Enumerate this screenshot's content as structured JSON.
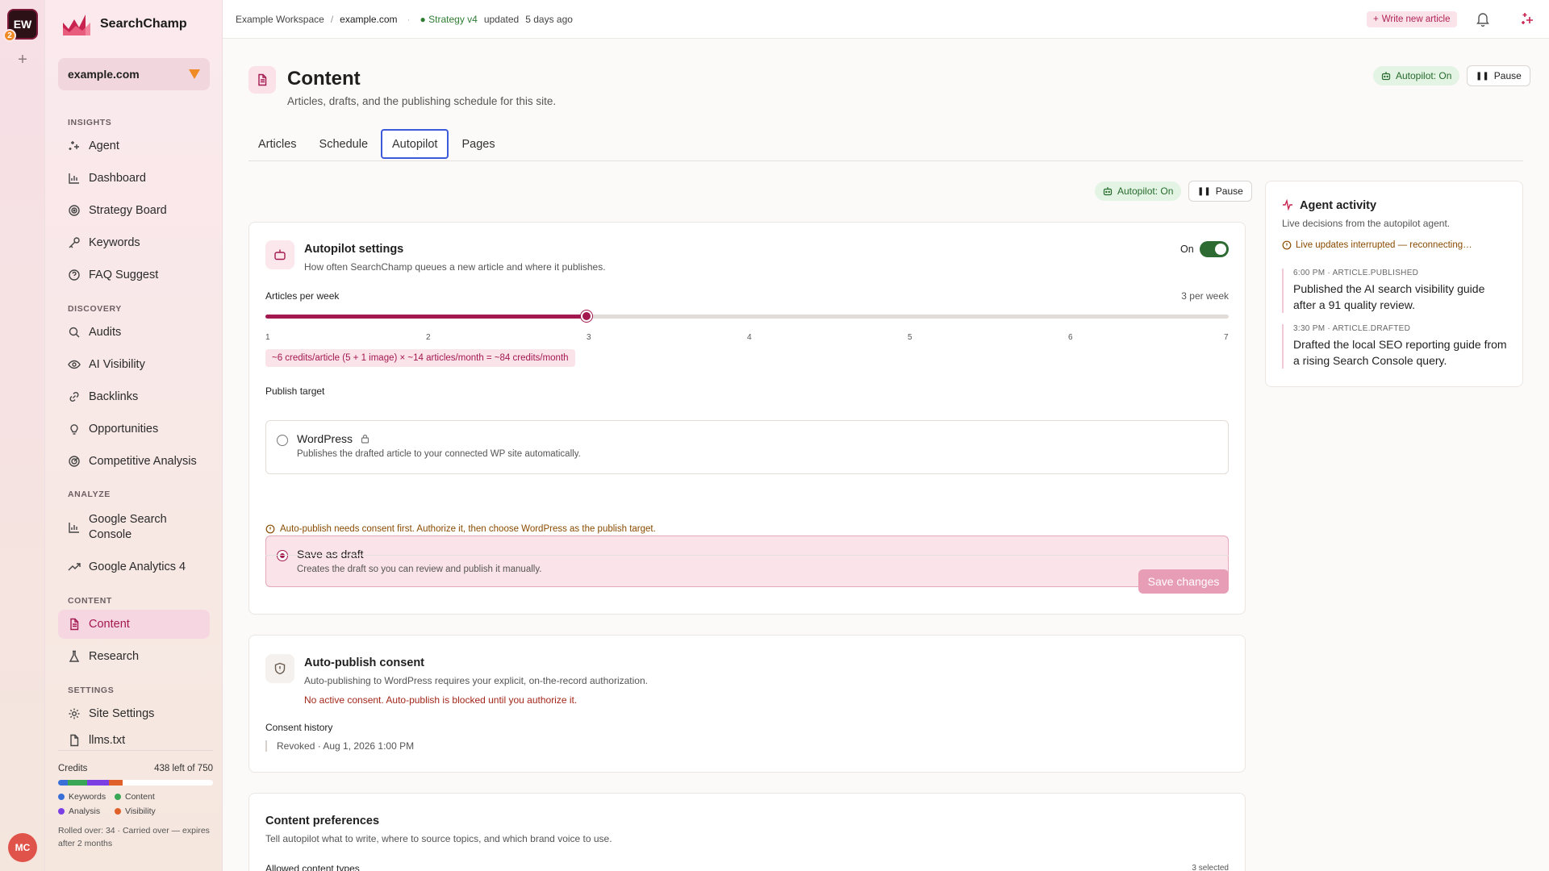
{
  "workspace": {
    "initials": "EW",
    "badge": "2",
    "add_label": "+"
  },
  "user": {
    "initials": "MC"
  },
  "brand": {
    "name": "SearchChamp"
  },
  "site_selector": {
    "value": "example.com"
  },
  "sidebar": {
    "insights_label": "INSIGHTS",
    "insights": [
      "Agent",
      "Dashboard",
      "Strategy Board",
      "Keywords",
      "FAQ Suggest"
    ],
    "discovery_label": "DISCOVERY",
    "discovery": [
      "Audits",
      "AI Visibility",
      "Backlinks",
      "Opportunities",
      "Competitive Analysis"
    ],
    "analyze_label": "ANALYZE",
    "analyze": [
      "Google Search Console",
      "Google Analytics 4"
    ],
    "content_label": "CONTENT",
    "content": [
      "Content",
      "Research"
    ],
    "settings_label": "SETTINGS",
    "settings": [
      "Site Settings",
      "llms.txt"
    ]
  },
  "credits": {
    "label": "Credits",
    "remaining": "438 left of 750",
    "segments": [
      {
        "name": "Keywords",
        "fraction": 0.06,
        "color": "#3b6fd8"
      },
      {
        "name": "Content",
        "fraction": 0.125,
        "color": "#3aa757"
      },
      {
        "name": "Analysis",
        "fraction": 0.145,
        "color": "#7b3fe4"
      },
      {
        "name": "Visibility",
        "fraction": 0.085,
        "color": "#e0602a"
      }
    ],
    "legend": [
      "Keywords",
      "Content",
      "Analysis",
      "Visibility"
    ],
    "rolled": "Rolled over: 34 · Carried over — expires after 2 months"
  },
  "topbar": {
    "workspace": "Example Workspace",
    "separator": "/",
    "site": "example.com",
    "strategy": "● Strategy v4",
    "updated": "updated",
    "updated_ago": "5 days ago",
    "write_button": "Write new article"
  },
  "header": {
    "title": "Content",
    "subtitle": "Articles, drafts, and the publishing schedule for this site.",
    "autopilot_status": "Autopilot: On",
    "pause_label": "Pause"
  },
  "tabs": [
    "Articles",
    "Schedule",
    "Autopilot",
    "Pages"
  ],
  "active_tab": "Autopilot",
  "autopilot_settings": {
    "title": "Autopilot settings",
    "description": "How often SearchChamp queues a new article and where it publishes.",
    "toggle_label": "On",
    "toggle_on": true,
    "slider_label": "Articles per week",
    "slider_value_text": "3 per week",
    "slider_value": 3,
    "slider_min": 1,
    "slider_max": 7,
    "ticks": [
      "1",
      "2",
      "3",
      "4",
      "5",
      "6",
      "7"
    ],
    "calc": "~6 credits/article (5 + 1 image) × ~14 articles/month = ~84 credits/month",
    "publish_target_label": "Publish target",
    "options": [
      {
        "title": "WordPress",
        "description": "Publishes the drafted article to your connected WP site automatically.",
        "selected": false,
        "locked": true
      },
      {
        "title": "Save as draft",
        "description": "Creates the draft so you can review and publish it manually.",
        "selected": true,
        "locked": false
      }
    ],
    "warning": "Auto-publish needs consent first. Authorize it, then choose WordPress as the publish target.",
    "save_button": "Save changes"
  },
  "consent": {
    "title": "Auto-publish consent",
    "description": "Auto-publishing to WordPress requires your explicit, on-the-record authorization.",
    "status": "No active consent. Auto-publish is blocked until you authorize it.",
    "history_label": "Consent history",
    "history": [
      "Revoked · Aug 1, 2026 1:00 PM"
    ]
  },
  "preferences": {
    "title": "Content preferences",
    "description": "Tell autopilot what to write, where to source topics, and which brand voice to use.",
    "allowed_label": "Allowed content types",
    "selected_count": "3 selected"
  },
  "activity": {
    "title": "Agent activity",
    "subtitle": "Live decisions from the autopilot agent.",
    "status": "Live updates interrupted — reconnecting…",
    "items": [
      {
        "time": "6:00 PM · ARTICLE.PUBLISHED",
        "text": "Published the AI search visibility guide after a 91 quality review."
      },
      {
        "time": "3:30 PM · ARTICLE.DRAFTED",
        "text": "Drafted the local SEO reporting guide from a rising Search Console query."
      }
    ]
  }
}
